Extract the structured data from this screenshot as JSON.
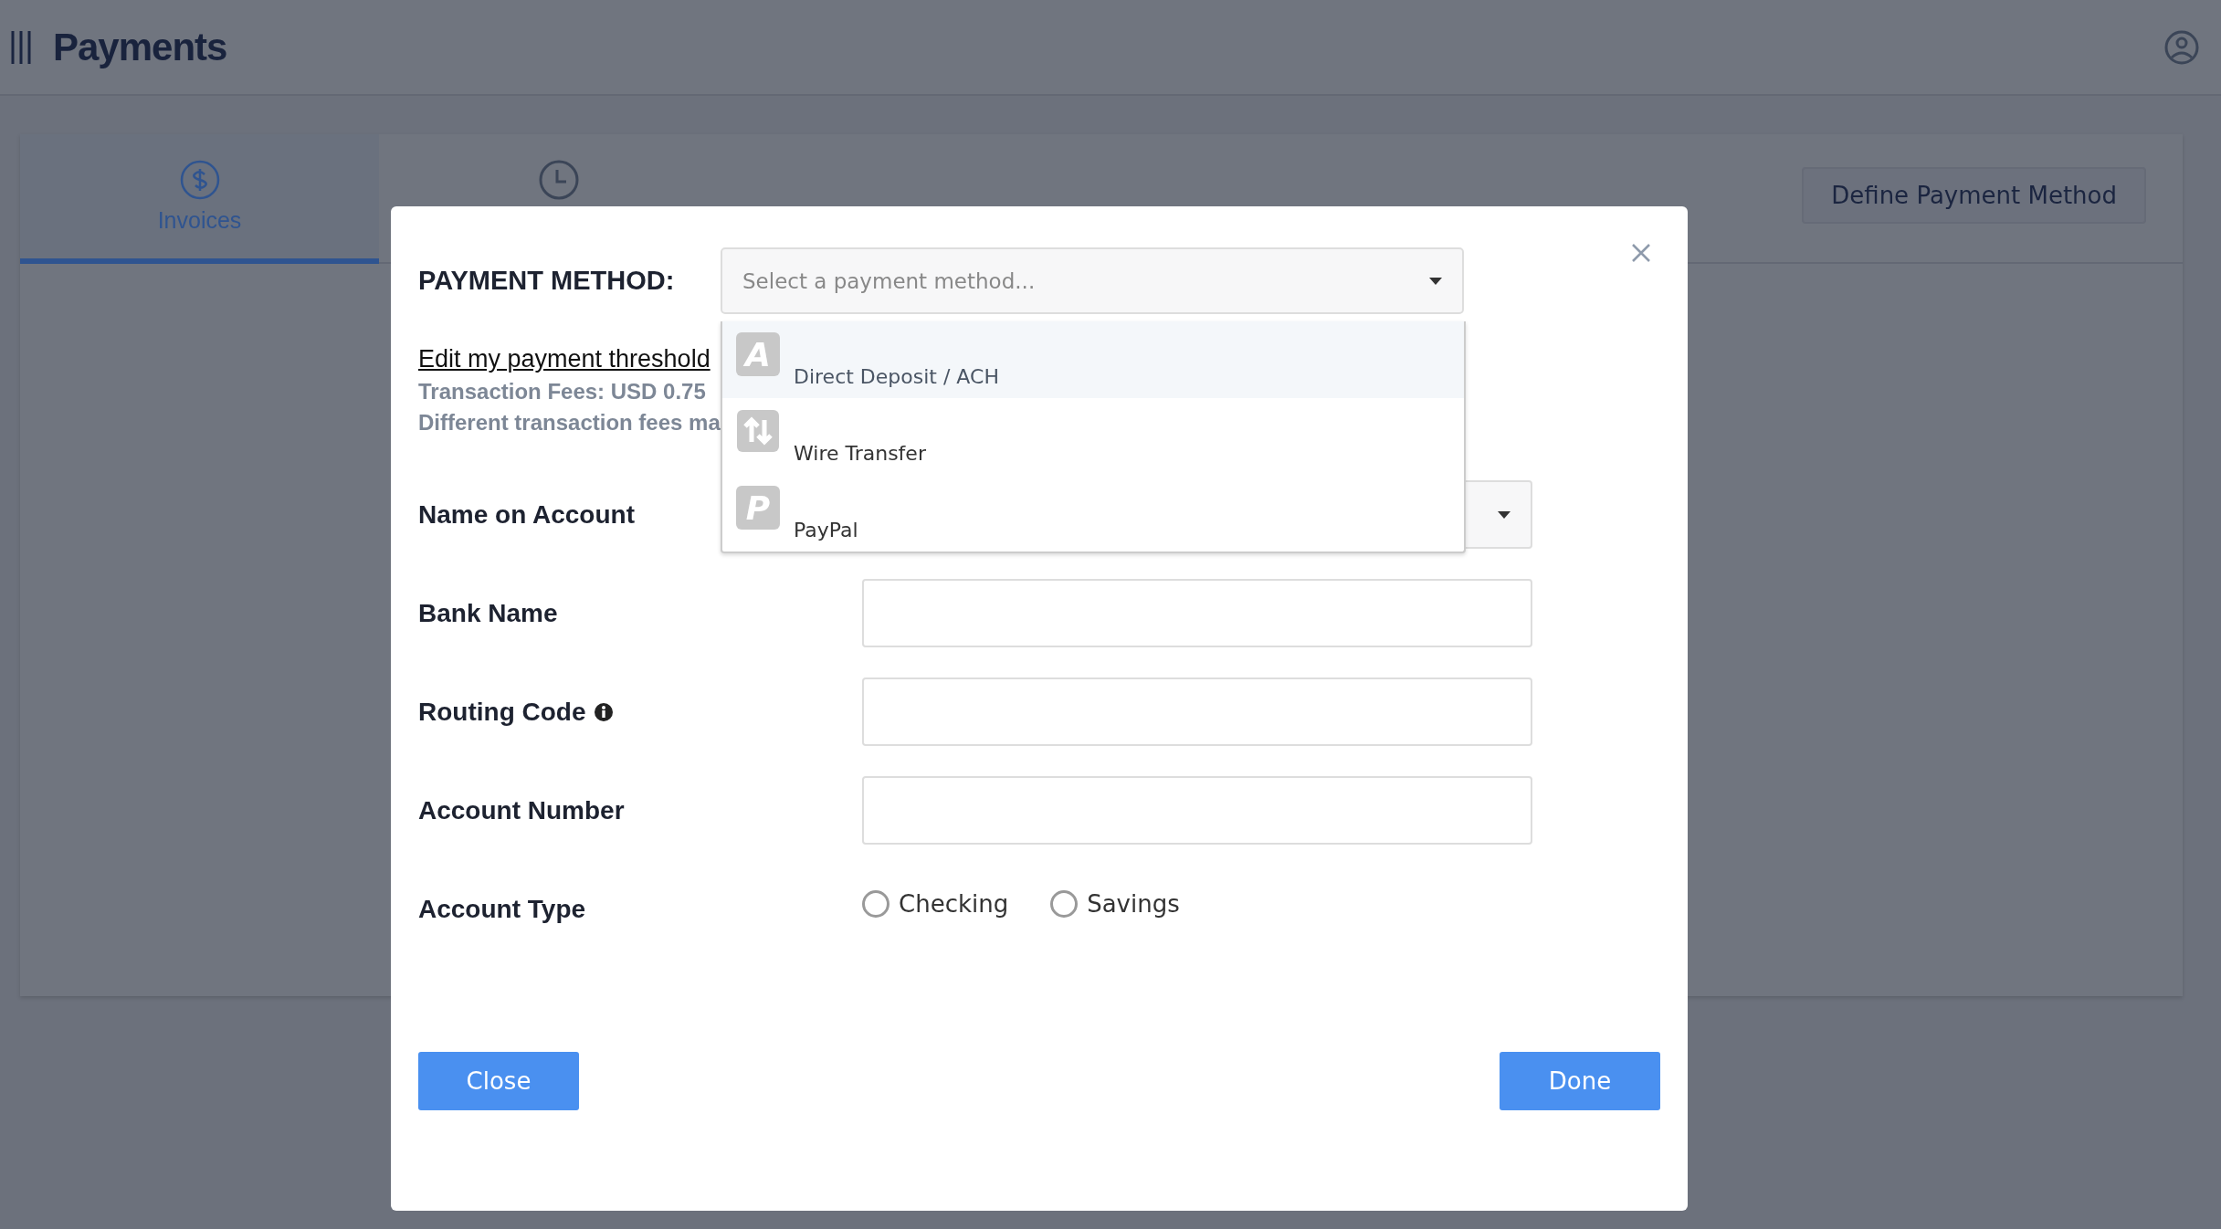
{
  "header": {
    "title": "Payments"
  },
  "tabs": [
    {
      "label": "Invoices",
      "kind": "dollar",
      "selected": true
    },
    {
      "kind": "clock",
      "selected": false
    }
  ],
  "define_button": "Define Payment Method",
  "modal": {
    "method_label": "PAYMENT METHOD:",
    "method_select": {
      "placeholder": "Select a payment method..."
    },
    "options": [
      {
        "label": "Direct Deposit / ACH",
        "badge": "A",
        "selected": true
      },
      {
        "label": "Wire Transfer",
        "kind": "transfer",
        "selected": false
      },
      {
        "label": "PayPal",
        "badge": "P",
        "selected": false
      }
    ],
    "threshold_link": "Edit my payment threshold",
    "fee_lines": [
      "Transaction Fees: USD 0.75",
      "Different transaction fees ma"
    ],
    "fields": [
      {
        "label": "Name on Account",
        "kind": "select"
      },
      {
        "label": "Bank Name",
        "kind": "text"
      },
      {
        "label": "Routing Code",
        "kind": "text",
        "info": true
      },
      {
        "label": "Account Number",
        "kind": "text"
      },
      {
        "label": "Account Type",
        "kind": "radio",
        "options": [
          {
            "label": "Checking",
            "checked": false
          },
          {
            "label": "Savings",
            "checked": false
          }
        ]
      }
    ],
    "buttons": [
      "Close",
      "Done"
    ]
  }
}
